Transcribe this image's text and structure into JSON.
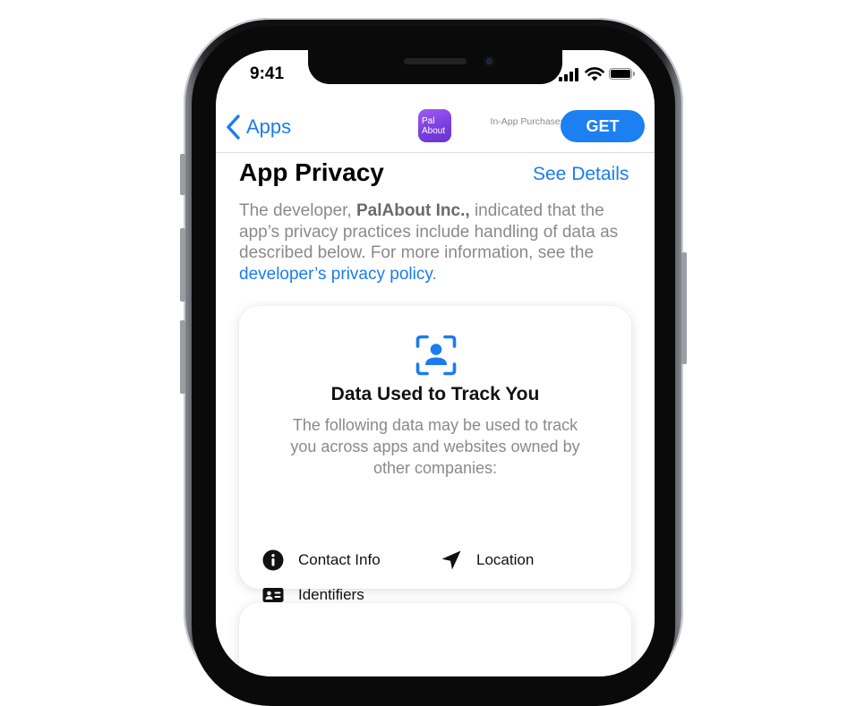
{
  "status_bar": {
    "time": "9:41"
  },
  "nav": {
    "back_label": "Apps",
    "app_icon_text": "Pal About",
    "in_app_purchases_label": "In-App Purchases",
    "get_label": "GET"
  },
  "section": {
    "title": "App Privacy",
    "see_details_label": "See Details",
    "description_before": "The developer, ",
    "developer_name": "PalAbout Inc.,",
    "description_middle": " indicated that the app’s privacy practices include handling of data as described below. For more information, see the ",
    "policy_link_label": "developer’s privacy policy",
    "description_after": "."
  },
  "tracking_card": {
    "icon": "person-viewfinder-icon",
    "title": "Data Used to Track You",
    "description": "The following data may be used to track you across apps and websites owned by other companies:",
    "items": [
      {
        "icon": "info-circle-icon",
        "label": "Contact Info"
      },
      {
        "icon": "location-arrow-icon",
        "label": "Location"
      },
      {
        "icon": "id-card-icon",
        "label": "Identifiers"
      }
    ]
  },
  "colors": {
    "accent": "#1a7cf0",
    "get_button": "#1c7ff2",
    "secondary_text": "#8a8a8e",
    "app_icon": "#7a3fe0"
  }
}
